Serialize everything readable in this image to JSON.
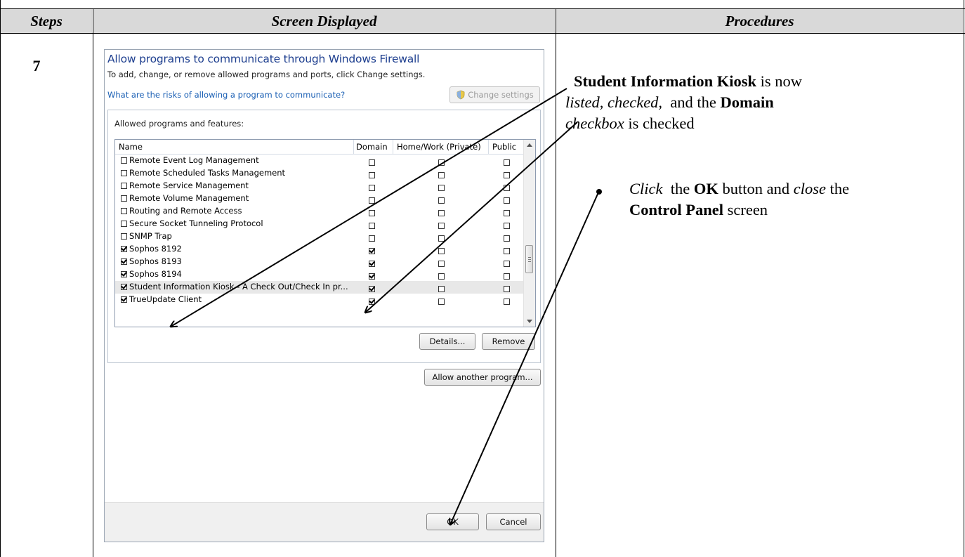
{
  "table": {
    "headers": {
      "steps": "Steps",
      "screen": "Screen Displayed",
      "procedures": "Procedures"
    },
    "step_number": "7"
  },
  "window": {
    "title": "Allow programs to communicate through Windows Firewall",
    "subtitle": "To add, change, or remove allowed programs and ports, click Change settings.",
    "risk_link": "What are the risks of allowing a program to communicate?",
    "change_settings_label": "Change settings",
    "group_label": "Allowed programs and features:",
    "columns": {
      "name": "Name",
      "domain": "Domain",
      "home": "Home/Work (Private)",
      "public": "Public"
    },
    "rows": [
      {
        "name": "Remote Event Log Management",
        "enabled": false,
        "domain": false,
        "home": false,
        "public": false
      },
      {
        "name": "Remote Scheduled Tasks Management",
        "enabled": false,
        "domain": false,
        "home": false,
        "public": false
      },
      {
        "name": "Remote Service Management",
        "enabled": false,
        "domain": false,
        "home": false,
        "public": false
      },
      {
        "name": "Remote Volume Management",
        "enabled": false,
        "domain": false,
        "home": false,
        "public": false
      },
      {
        "name": "Routing and Remote Access",
        "enabled": false,
        "domain": false,
        "home": false,
        "public": false
      },
      {
        "name": "Secure Socket Tunneling Protocol",
        "enabled": false,
        "domain": false,
        "home": false,
        "public": false
      },
      {
        "name": "SNMP Trap",
        "enabled": false,
        "domain": false,
        "home": false,
        "public": false
      },
      {
        "name": "Sophos 8192",
        "enabled": true,
        "domain": true,
        "home": false,
        "public": false
      },
      {
        "name": "Sophos 8193",
        "enabled": true,
        "domain": true,
        "home": false,
        "public": false
      },
      {
        "name": "Sophos 8194",
        "enabled": true,
        "domain": true,
        "home": false,
        "public": false
      },
      {
        "name": "Student Information Kiosk  -  A Check Out/Check In pr...",
        "enabled": true,
        "domain": true,
        "home": false,
        "public": false,
        "selected": true
      },
      {
        "name": "TrueUpdate Client",
        "enabled": true,
        "domain": true,
        "home": false,
        "public": false
      }
    ],
    "details_label": "Details...",
    "remove_label": "Remove",
    "allow_another_label": "Allow another program...",
    "ok_label": "OK",
    "cancel_label": "Cancel"
  },
  "procedures": {
    "line1_bold": "Student Information Kiosk",
    "line1_rest": " is now",
    "line2_italic": "listed, checked,",
    "line2_mid": "  and the ",
    "line2_bold": "Domain",
    "line3_italic": "checkbox",
    "line3_rest": " is checked",
    "bullet_click": "Click",
    "bullet_the": "  the ",
    "bullet_ok": "OK",
    "bullet_button_and": " button and ",
    "bullet_close": "close",
    "bullet_the2": " the",
    "bullet_control_panel": "Control Panel",
    "bullet_screen": " screen"
  }
}
